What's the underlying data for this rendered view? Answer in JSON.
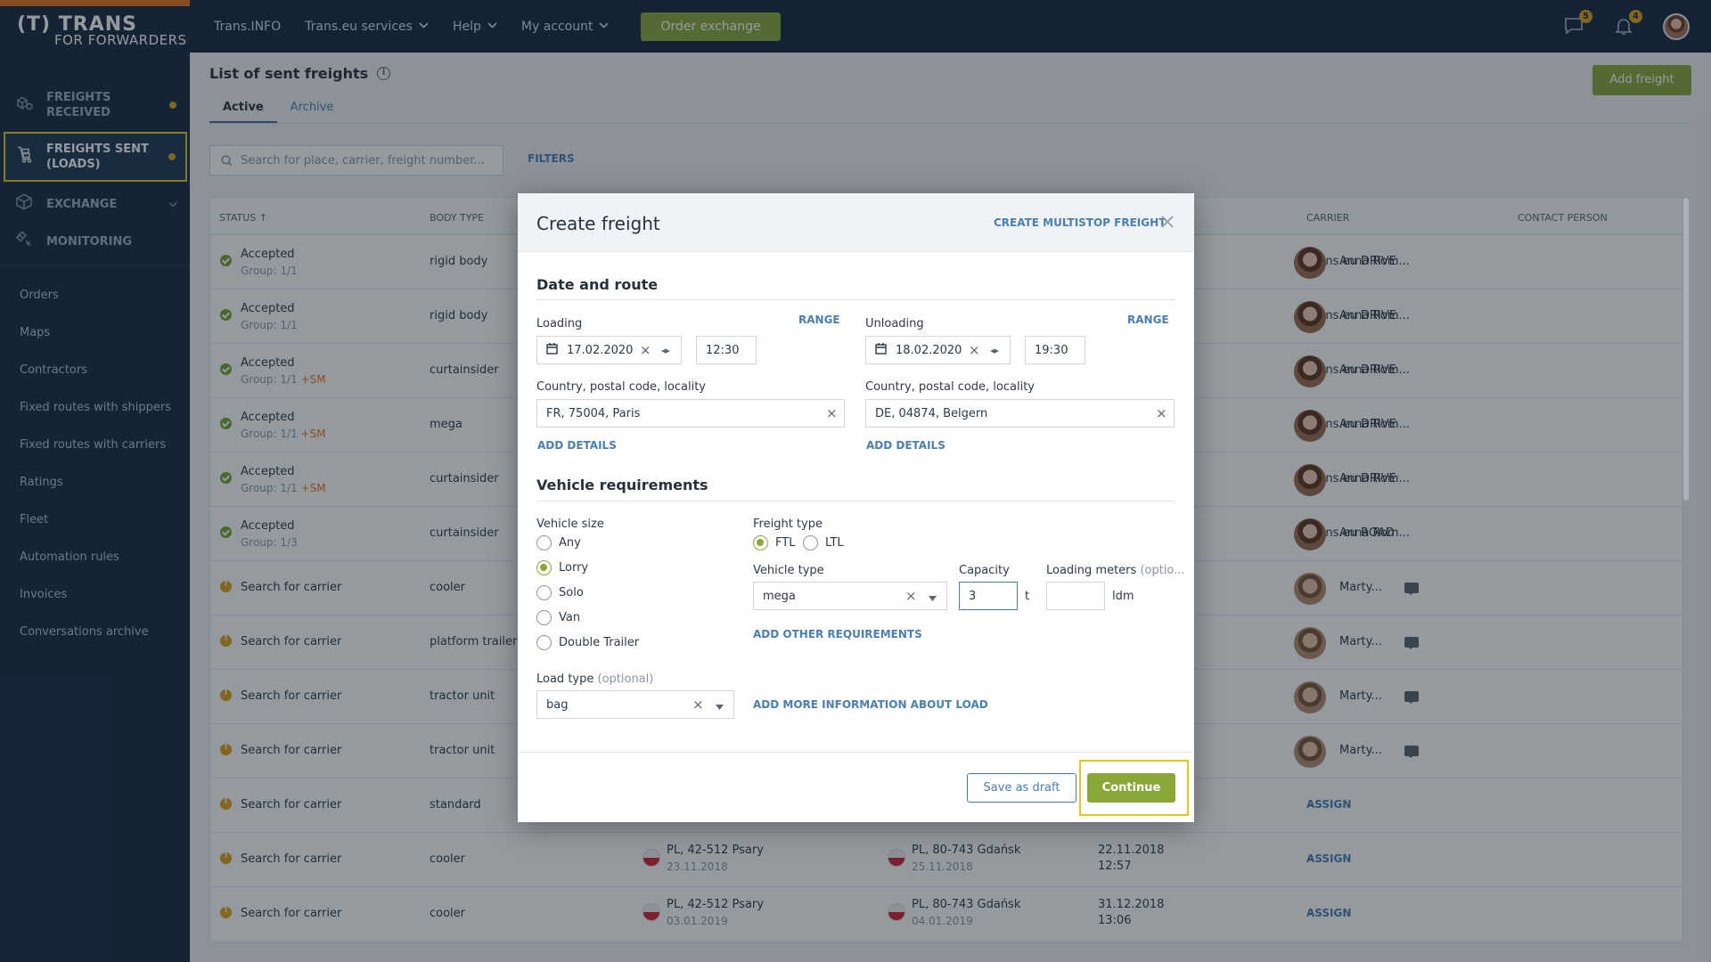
{
  "sidebar": {
    "logo_line1": "(T) TRANS",
    "logo_line2_for": "FOR",
    "logo_line2_word": "FORWARDERS",
    "main_items": [
      {
        "label1": "FREIGHTS",
        "label2": "RECEIVED",
        "icon": "boxes-icon"
      },
      {
        "label1": "FREIGHTS SENT",
        "label2": "(LOADS)",
        "icon": "dolly-icon"
      },
      {
        "label1": "EXCHANGE",
        "icon": "cube-icon"
      },
      {
        "label1": "MONITORING",
        "icon": "satellite-icon"
      }
    ],
    "links": [
      "Orders",
      "Maps",
      "Contractors",
      "Fixed routes with shippers",
      "Fixed routes with carriers",
      "Ratings",
      "Fleet",
      "Automation rules",
      "Invoices",
      "Conversations archive"
    ]
  },
  "topbar": {
    "items": [
      "Trans.INFO",
      "Trans.eu services",
      "Help",
      "My account"
    ],
    "order_exchange": "Order exchange",
    "messages_count": "5",
    "notifications_count": "4"
  },
  "page": {
    "title": "List of sent freights",
    "tabs": [
      "Active",
      "Archive"
    ],
    "add_freight": "Add freight",
    "search_placeholder": "Search for place, carrier, freight number...",
    "filters": "FILTERS"
  },
  "table": {
    "headers": {
      "status": "STATUS ↑",
      "body_type": "BODY TYPE",
      "carrier": "CARRIER",
      "contact": "CONTACT PERSON"
    },
    "rows": [
      {
        "status": "Accepted",
        "group": "Group: 1/1",
        "sm": "",
        "body": "rigid body",
        "carrier": "Trans.eu DRIVE",
        "contact": "Anna Rom..."
      },
      {
        "status": "Accepted",
        "group": "Group: 1/1",
        "sm": "",
        "body": "rigid body",
        "carrier": "Trans.eu DRIVE",
        "contact": "Anna Rom..."
      },
      {
        "status": "Accepted",
        "group": "Group: 1/1",
        "sm": "+SM",
        "body": "curtainsider",
        "carrier": "Trans.eu DRIVE",
        "contact": "Anna Rom..."
      },
      {
        "status": "Accepted",
        "group": "Group: 1/1",
        "sm": "+SM",
        "body": "mega",
        "carrier": "Trans.eu DRIVE",
        "contact": "Anna Rom..."
      },
      {
        "status": "Accepted",
        "group": "Group: 1/1",
        "sm": "+SM",
        "body": "curtainsider",
        "carrier": "Trans.eu DRIVE",
        "contact": "Anna Rom..."
      },
      {
        "status": "Accepted",
        "group": "Group: 1/3",
        "sm": "",
        "body": "curtainsider",
        "carrier": "Trans.eu ROAD",
        "contact": "Anna Rom..."
      },
      {
        "status": "Search for carrier",
        "body": "cooler",
        "carrier": "-",
        "contact": "Marty..."
      },
      {
        "status": "Search for carrier",
        "body": "platform trailer",
        "carrier": "-",
        "contact": "Marty..."
      },
      {
        "status": "Search for carrier",
        "body": "tractor unit",
        "carrier": "-",
        "contact": "Marty..."
      },
      {
        "status": "Search for carrier",
        "body": "tractor unit",
        "carrier": "-",
        "contact": "Marty..."
      },
      {
        "status": "Search for carrier",
        "body": "standard",
        "carrier": "-",
        "assign": "ASSIGN"
      },
      {
        "status": "Search for carrier",
        "body": "cooler",
        "from": "PL, 42-512 Psary",
        "from_date": "23.11.2018",
        "to": "PL, 80-743 Gdańsk",
        "to_date": "25.11.2018",
        "date": "22.11.2018",
        "time": "12:57",
        "carrier": "-",
        "assign": "ASSIGN"
      },
      {
        "status": "Search for carrier",
        "body": "cooler",
        "from": "PL, 42-512 Psary",
        "from_date": "03.01.2019",
        "to": "PL, 80-743 Gdańsk",
        "to_date": "04.01.2019",
        "date": "31.12.2018",
        "time": "13:06",
        "carrier": "-",
        "assign": "ASSIGN"
      }
    ]
  },
  "modal": {
    "title": "Create freight",
    "multistop": "CREATE MULTISTOP FREIGHT",
    "section_route": "Date and route",
    "loading": {
      "label": "Loading",
      "range": "RANGE",
      "date": "17.02.2020",
      "time": "12:30",
      "place_label": "Country, postal code, locality",
      "place": "FR, 75004, Paris",
      "add_details": "ADD DETAILS"
    },
    "unloading": {
      "label": "Unloading",
      "range": "RANGE",
      "date": "18.02.2020",
      "time": "19:30",
      "place_label": "Country, postal code, locality",
      "place": "DE, 04874, Belgern",
      "add_details": "ADD DETAILS"
    },
    "section_vehicle": "Vehicle requirements",
    "vehicle_size_label": "Vehicle size",
    "vehicle_sizes": [
      "Any",
      "Lorry",
      "Solo",
      "Van",
      "Double Trailer"
    ],
    "freight_type_label": "Freight type",
    "freight_types": [
      "FTL",
      "LTL"
    ],
    "vehicle_type_label": "Vehicle type",
    "vehicle_type": "mega",
    "capacity_label": "Capacity",
    "capacity": "3",
    "capacity_unit": "t",
    "loading_meters_label": "Loading meters",
    "loading_meters_optional": "(optio...",
    "loading_meters_unit": "ldm",
    "add_other": "ADD OTHER REQUIREMENTS",
    "load_type_label": "Load type",
    "load_type_optional": "(optional)",
    "load_type": "bag",
    "add_more_info": "ADD MORE INFORMATION ABOUT LOAD",
    "save_draft": "Save as draft",
    "continue": "Continue"
  }
}
